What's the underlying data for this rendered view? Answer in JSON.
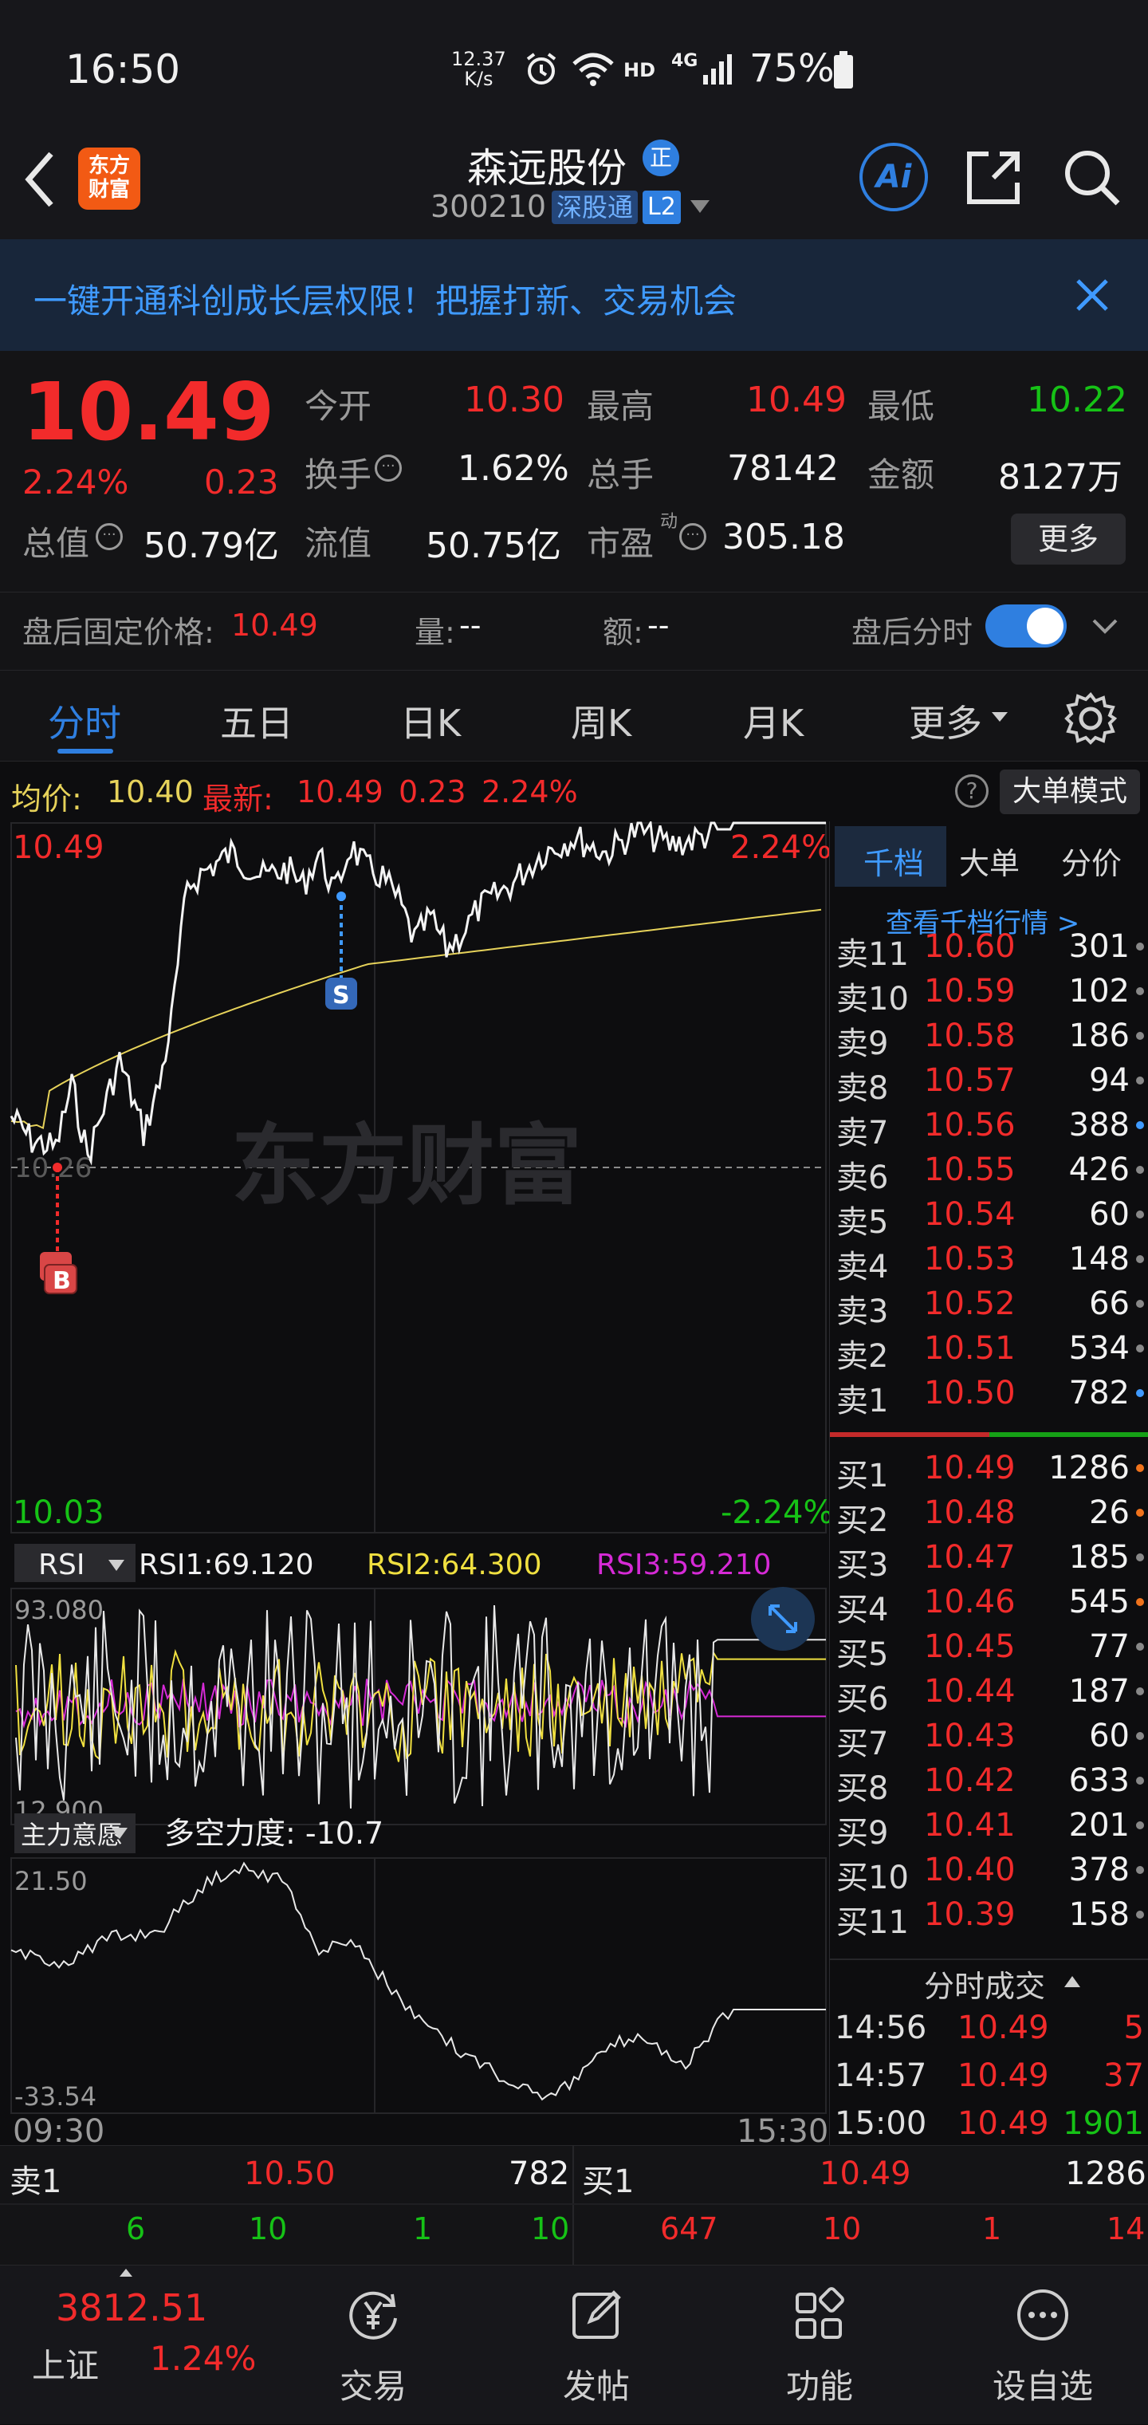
{
  "status_bar": {
    "time": "16:50",
    "net_speed_top": "12.37",
    "net_speed_bottom": "K/s",
    "hd": "HD",
    "network": "4G",
    "battery": "75%"
  },
  "app_logo": {
    "line1": "东方",
    "line2": "财富"
  },
  "stock": {
    "name": "森远股份",
    "name_badge": "正",
    "code": "300210",
    "connect": "深股通",
    "level": "L2"
  },
  "banner": {
    "text": "一键开通科创成长层权限！把握打新、交易机会"
  },
  "quote": {
    "price": "10.49",
    "change_pct": "2.24%",
    "change": "0.23",
    "open_label": "今开",
    "open": "10.30",
    "high_label": "最高",
    "high": "10.49",
    "low_label": "最低",
    "low": "10.22",
    "turnover_label": "换手",
    "turnover": "1.62%",
    "volume_label": "总手",
    "volume": "78142",
    "amount_label": "金额",
    "amount": "8127万",
    "mktcap_label": "总值",
    "mktcap": "50.79亿",
    "float_label": "流值",
    "float_cap": "50.75亿",
    "pe_label": "市盈",
    "pe_sup": "动",
    "pe": "305.18",
    "more": "更多"
  },
  "after_hours": {
    "price_label": "盘后固定价格:",
    "price": "10.49",
    "vol_label": "量:",
    "vol": "--",
    "amt_label": "额:",
    "amt": "--",
    "toggle_label": "盘后分时"
  },
  "tabs": [
    "分时",
    "五日",
    "日K",
    "周K",
    "月K",
    "更多"
  ],
  "chart_info": {
    "avg_label": "均价:",
    "avg": "10.40",
    "latest_label": "最新:",
    "latest": "10.49",
    "chg": "0.23",
    "pct": "2.24%",
    "mode_btn": "大单模式"
  },
  "main_chart": {
    "top_price": "10.49",
    "top_pct": "2.24%",
    "mid_price": "10.26",
    "bottom_price": "10.03",
    "bottom_pct": "-2.24%",
    "watermark": "东方财富",
    "b_marker": "B",
    "s_marker": "S"
  },
  "rsi": {
    "selector": "RSI",
    "rsi1": "RSI1:69.120",
    "rsi2": "RSI2:64.300",
    "rsi3": "RSI3:59.210",
    "top": "93.080",
    "bottom": "12.900"
  },
  "intent": {
    "selector": "主力意愿",
    "text": "多空力度: -10.7",
    "top": "21.50",
    "bottom": "-33.54"
  },
  "time_axis": {
    "start": "09:30",
    "end": "15:30"
  },
  "right_tabs": [
    "千档",
    "大单",
    "分价"
  ],
  "view_all": "查看千档行情 >",
  "asks": [
    {
      "label": "卖11",
      "price": "10.60",
      "vol": "301"
    },
    {
      "label": "卖10",
      "price": "10.59",
      "vol": "102"
    },
    {
      "label": "卖9",
      "price": "10.58",
      "vol": "186"
    },
    {
      "label": "卖8",
      "price": "10.57",
      "vol": "94"
    },
    {
      "label": "卖7",
      "price": "10.56",
      "vol": "388"
    },
    {
      "label": "卖6",
      "price": "10.55",
      "vol": "426"
    },
    {
      "label": "卖5",
      "price": "10.54",
      "vol": "60"
    },
    {
      "label": "卖4",
      "price": "10.53",
      "vol": "148"
    },
    {
      "label": "卖3",
      "price": "10.52",
      "vol": "66"
    },
    {
      "label": "卖2",
      "price": "10.51",
      "vol": "534"
    },
    {
      "label": "卖1",
      "price": "10.50",
      "vol": "782"
    }
  ],
  "bids": [
    {
      "label": "买1",
      "price": "10.49",
      "vol": "1286"
    },
    {
      "label": "买2",
      "price": "10.48",
      "vol": "26"
    },
    {
      "label": "买3",
      "price": "10.47",
      "vol": "185"
    },
    {
      "label": "买4",
      "price": "10.46",
      "vol": "545"
    },
    {
      "label": "买5",
      "price": "10.45",
      "vol": "77"
    },
    {
      "label": "买6",
      "price": "10.44",
      "vol": "187"
    },
    {
      "label": "买7",
      "price": "10.43",
      "vol": "60"
    },
    {
      "label": "买8",
      "price": "10.42",
      "vol": "633"
    },
    {
      "label": "买9",
      "price": "10.41",
      "vol": "201"
    },
    {
      "label": "买10",
      "price": "10.40",
      "vol": "378"
    },
    {
      "label": "买11",
      "price": "10.39",
      "vol": "158"
    }
  ],
  "ticks_title": "分时成交",
  "ticks": [
    {
      "time": "14:56",
      "price": "10.49",
      "vol": "5"
    },
    {
      "time": "14:57",
      "price": "10.49",
      "vol": "37"
    },
    {
      "time": "15:00",
      "price": "10.49",
      "vol": "1901"
    }
  ],
  "bottom_quote": {
    "ask_label": "卖1",
    "ask_price": "10.50",
    "ask_vol": "782",
    "bid_label": "买1",
    "bid_price": "10.49",
    "bid_vol": "1286",
    "ask_details": [
      "6",
      "10",
      "1",
      "10"
    ],
    "bid_details": [
      "647",
      "10",
      "1",
      "14"
    ]
  },
  "index": {
    "value": "3812.51",
    "name": "上证",
    "pct": "1.24%"
  },
  "nav": [
    "交易",
    "发帖",
    "功能",
    "设自选"
  ],
  "colors": {
    "up": "#f22b2b",
    "down": "#16c216",
    "accent": "#2f7fe0",
    "avg_line": "#e6d25a",
    "rsi2": "#f0e040",
    "rsi3": "#d62ad6"
  }
}
